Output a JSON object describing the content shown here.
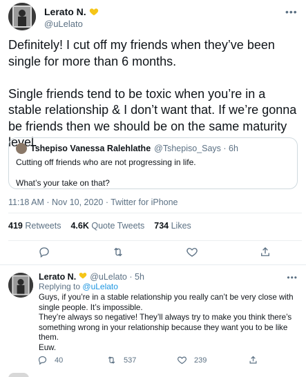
{
  "main_tweet": {
    "display_name": "Lerato N.",
    "handle": "@uLelato",
    "more_label": "•••",
    "text_lines": [
      "Definitely! I cut off my friends when they’ve been single for more than 6 months.",
      "Single friends tend to be toxic when you’re in a stable relationship & I don’t want that. If we’re gonna be friends then we should be on the same maturity level."
    ],
    "quote": {
      "name": "Tshepiso Vanessa Ralehlathe",
      "meta": "@Tshepiso_Says · 6h",
      "lines": [
        "Cutting off friends who are not progressing in life.",
        "What’s your take on that?"
      ]
    },
    "timestamp": "11:18 AM · Nov 10, 2020 · Twitter for iPhone",
    "stats": [
      {
        "value": "419",
        "label": "Retweets"
      },
      {
        "value": "4.6K",
        "label": "Quote Tweets"
      },
      {
        "value": "734",
        "label": "Likes"
      }
    ],
    "actions": [
      {
        "icon": "reply-icon"
      },
      {
        "icon": "retweet-icon"
      },
      {
        "icon": "like-icon"
      },
      {
        "icon": "share-icon"
      }
    ]
  },
  "reply_tweet": {
    "display_name": "Lerato N.",
    "meta": "@uLelato · 5h",
    "replying_prefix": "Replying to",
    "replying_handle": "@uLelato",
    "more_label": "•••",
    "text": "Guys, if you’re in a stable relationship you really can’t be very close with single people. It’s impossible.\nThey’re always so negative! They’ll always try to make you think there’s something wrong in your relationship because they want you to be like them.\nEuw.",
    "actions": [
      {
        "icon": "reply-icon",
        "count": "40"
      },
      {
        "icon": "retweet-icon",
        "count": "537"
      },
      {
        "icon": "like-icon",
        "count": "239"
      },
      {
        "icon": "share-icon",
        "count": ""
      }
    ]
  },
  "colors": {
    "secondary_text": "#5b7083",
    "link": "#1b95e0",
    "heart_emoji": "#f5c518",
    "divider": "#ebeef0"
  }
}
